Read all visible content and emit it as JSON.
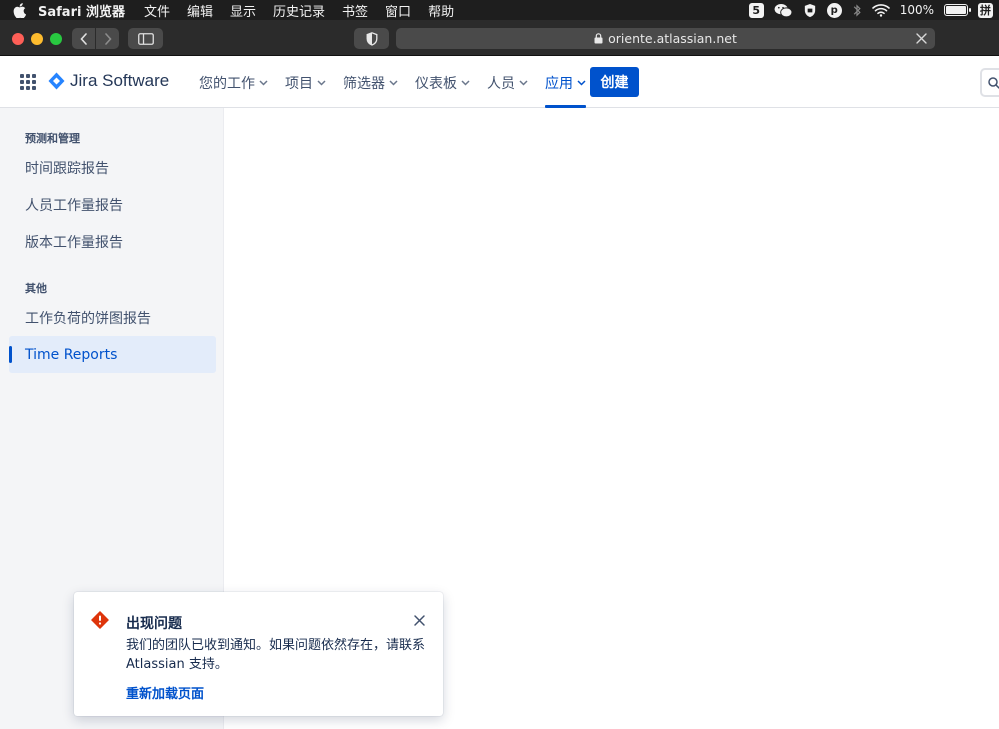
{
  "menubar": {
    "app_name": "Safari 浏览器",
    "items": [
      "文件",
      "编辑",
      "显示",
      "历史记录",
      "书签",
      "窗口",
      "帮助"
    ],
    "status": {
      "badge_5": "5",
      "p_badge": "p",
      "battery": "100%",
      "battery_level": 1.0,
      "input_method": "拼"
    }
  },
  "browser": {
    "url": "oriente.atlassian.net"
  },
  "header": {
    "product_name": "Jira Software",
    "nav": [
      {
        "label": "您的工作"
      },
      {
        "label": "项目"
      },
      {
        "label": "筛选器"
      },
      {
        "label": "仪表板"
      },
      {
        "label": "人员"
      },
      {
        "label": "应用"
      }
    ],
    "active_nav": "应用",
    "create_label": "创建"
  },
  "sidebar": {
    "section1": {
      "title": "预测和管理",
      "items": [
        "时间跟踪报告",
        "人员工作量报告",
        "版本工作量报告"
      ]
    },
    "section2": {
      "title": "其他",
      "items": [
        "工作负荷的饼图报告",
        "Time Reports"
      ]
    },
    "active_item": "Time Reports"
  },
  "flag": {
    "title": "出现问题",
    "message": "我们的团队已收到通知。如果问题依然存在，请联系 Atlassian 支持。",
    "action": "重新加载页面"
  },
  "colors": {
    "primary": "#0052cc",
    "error": "#de350b",
    "sidebar_bg": "#f4f5f7",
    "active_bg": "#e3ecfa"
  }
}
